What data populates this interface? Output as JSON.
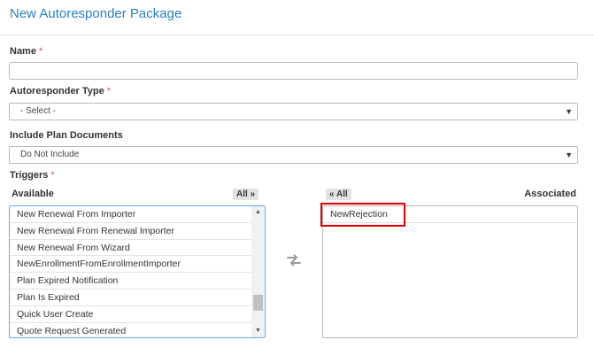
{
  "page": {
    "title": "New Autoresponder Package"
  },
  "form": {
    "name": {
      "label": "Name",
      "required_mark": "*",
      "value": ""
    },
    "autoresponder_type": {
      "label": "Autoresponder Type",
      "required_mark": "*",
      "selected": "- Select -"
    },
    "include_plan_documents": {
      "label": "Include Plan Documents",
      "selected": "Do Not Include"
    },
    "triggers": {
      "label": "Triggers",
      "required_mark": "*",
      "available": {
        "heading": "Available",
        "all_button": "All »",
        "items": [
          "New Renewal From Importer",
          "New Renewal From Renewal Importer",
          "New Renewal From Wizard",
          "NewEnrollmentFromEnrollmentImporter",
          "Plan Expired Notification",
          "Plan Is Expired",
          "Quick User Create",
          "Quote Request Generated"
        ]
      },
      "associated": {
        "heading": "Associated",
        "all_button": "« All",
        "items": [
          "NewRejection"
        ]
      }
    }
  },
  "icons": {
    "caret": "caret-down-icon",
    "transfer": "transfer-arrows-icon",
    "scroll_up": "scroll-up-arrow-icon",
    "scroll_down": "scroll-down-arrow-icon"
  },
  "colors": {
    "title_blue": "#2a7fbf",
    "required_red": "#d9534f",
    "focus_border": "#66afe9",
    "highlight_red": "#e00000"
  }
}
